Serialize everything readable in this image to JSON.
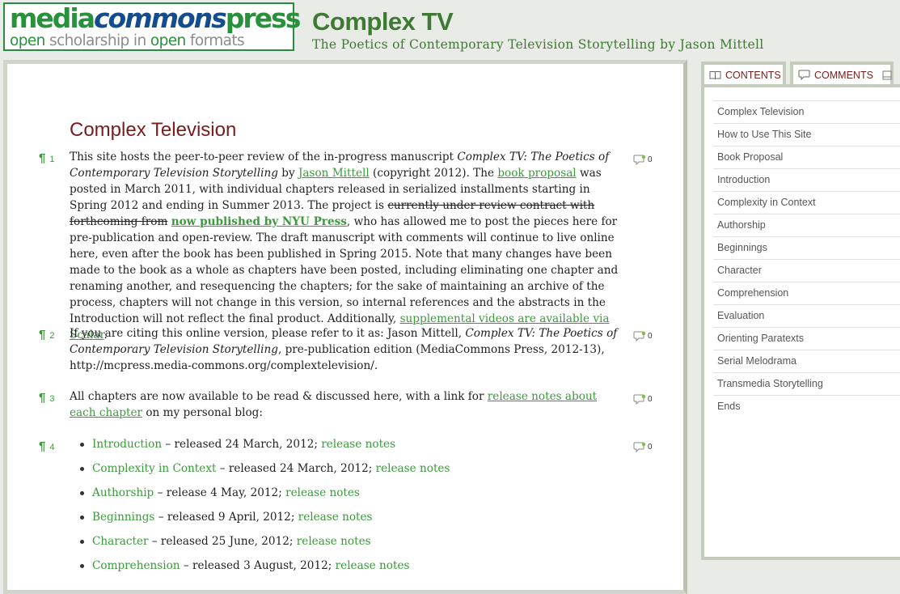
{
  "logo": {
    "media": "media",
    "commons": "commons",
    "press": "press",
    "tagline_open1": "open",
    "tagline_scholarship": " scholarship in ",
    "tagline_open2": "open",
    "tagline_formats": " formats"
  },
  "site": {
    "title": "Complex TV",
    "subtitle": "The Poetics of Contemporary Television Storytelling by Jason Mittell"
  },
  "tabs": {
    "contents": "CONTENTS",
    "comments": "COMMENTS"
  },
  "toc": [
    "Complex Television",
    "How to Use This Site",
    "Book Proposal",
    "Introduction",
    "Complexity in Context",
    "Authorship",
    "Beginnings",
    "Character",
    "Comprehension",
    "Evaluation",
    "Orienting Paratexts",
    "Serial Melodrama",
    "Transmedia Storytelling",
    "Ends"
  ],
  "page": {
    "title": "Complex Television",
    "p1": {
      "num": "1",
      "comments": "0",
      "t1": "This site hosts the peer-to-peer review of the in-progress manuscript ",
      "i1": "Complex TV: The Poetics of Contemporary Television Storytelling",
      "t2": " by ",
      "link_author": "Jason Mittell",
      "t3": " (copyright 2012). The ",
      "link_proposal": "book proposal",
      "t4": " was posted in March 2011, with individual chapters released in serialized installments starting in Spring 2012 and ending in Summer 2013. The project is ",
      "strike1": "currently under review contract with forthcoming from",
      "t5": " ",
      "link_nyu": "now published by NYU Press",
      "t6": ", who has allowed me to post the pieces here for pre-publication and open-review. The draft manuscript with comments will continue to live online here, even after the book has been published in Spring 2015. Note that many changes have been made to the book as a whole as chapters have been posted, including eliminating one chapter and renaming another, and resequencing the chapters; for the sake of maintaining an archive of the process, chapters will not change in this version, so internal references and the abstracts in the Introduction will not reflect the final product. Additionally, ",
      "link_scalar": "supplemental videos are available via Scalar",
      "t7": "."
    },
    "p2": {
      "num": "2",
      "comments": "0",
      "t1": "If you are citing this online version, please refer to it as: Jason Mittell, ",
      "i1": "Complex TV: The Poetics of Contemporary Television Storytelling",
      "t2": ", pre-publication edition (MediaCommons Press, 2012-13), http://mcpress.media-commons.org/complextelevision/."
    },
    "p3": {
      "num": "3",
      "comments": "0",
      "t1": "All chapters are now available to be read & discussed here, with a link for ",
      "link_notes": "release notes about each chapter",
      "t2": " on my personal blog:"
    },
    "p4": {
      "num": "4",
      "comments": "0",
      "items": [
        {
          "chapter": "Introduction",
          "release": " – released 24 March, 2012; ",
          "notes": "release notes"
        },
        {
          "chapter": "Complexity in Context",
          "release": " – released 24 March, 2012; ",
          "notes": "release notes"
        },
        {
          "chapter": "Authorship",
          "release": " – release 4 May, 2012; ",
          "notes": "release notes"
        },
        {
          "chapter": "Beginnings",
          "release": " – released 9 April, 2012; ",
          "notes": "release notes"
        },
        {
          "chapter": "Character",
          "release": " – released 25 June, 2012; ",
          "notes": "release notes"
        },
        {
          "chapter": "Comprehension",
          "release": " – released 3 August, 2012; ",
          "notes": "release notes"
        }
      ]
    }
  },
  "colors": {
    "accent_green": "#3a9a3a",
    "title_red": "#7b1c1c",
    "logo_blue": "#134c8f"
  }
}
